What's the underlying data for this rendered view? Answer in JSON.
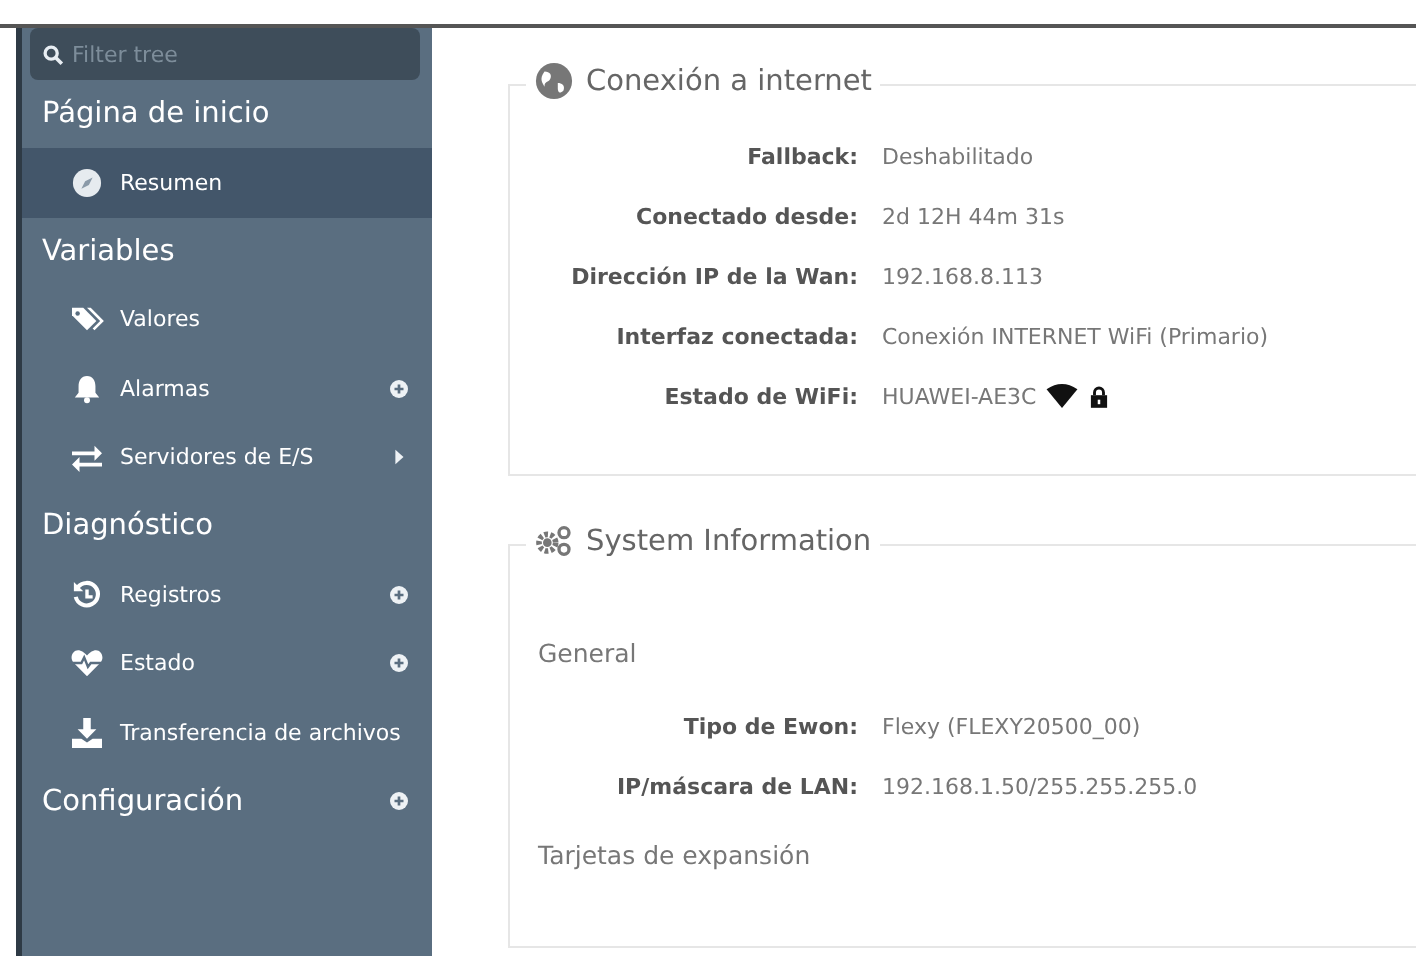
{
  "filter": {
    "placeholder": "Filter tree"
  },
  "nav": [
    {
      "kind": "heading",
      "label": "Página de inicio"
    },
    {
      "kind": "item",
      "label": "Resumen",
      "selected": true
    },
    {
      "kind": "heading",
      "label": "Variables"
    },
    {
      "kind": "item",
      "label": "Valores",
      "selected": false
    },
    {
      "kind": "item",
      "label": "Alarmas",
      "selected": false,
      "expandable": true
    },
    {
      "kind": "item",
      "label": "Servidores de E/S",
      "selected": false,
      "submenu": true
    },
    {
      "kind": "heading",
      "label": "Diagnóstico"
    },
    {
      "kind": "item",
      "label": "Registros",
      "selected": false,
      "expandable": true
    },
    {
      "kind": "item",
      "label": "Estado",
      "selected": false,
      "expandable": true
    },
    {
      "kind": "item",
      "label": "Transferencia de archivos",
      "selected": false
    },
    {
      "kind": "heading",
      "label": "Configuración",
      "expandable": true
    }
  ],
  "sections": [
    {
      "title": "Conexión a internet",
      "blocks": [
        {
          "kind": "row",
          "label": "Fallback:",
          "value": "Deshabilitado"
        },
        {
          "kind": "row",
          "label": "Conectado desde:",
          "value": "2d 12H 44m 31s"
        },
        {
          "kind": "row",
          "label": "Dirección IP de la Wan:",
          "value": "192.168.8.113"
        },
        {
          "kind": "row",
          "label": "Interfaz conectada:",
          "value": "Conexión INTERNET WiFi (Primario)"
        },
        {
          "kind": "wifi",
          "label": "Estado de WiFi:",
          "value": "HUAWEI-AE3C"
        }
      ]
    },
    {
      "title": "System Information",
      "blocks": [
        {
          "kind": "heading",
          "text": "General"
        },
        {
          "kind": "row",
          "label": "Tipo de Ewon:",
          "value": "Flexy (FLEXY20500_00)"
        },
        {
          "kind": "row",
          "label": "IP/máscara de LAN:",
          "value": "192.168.1.50/255.255.255.0"
        },
        {
          "kind": "heading",
          "text": "Tarjetas de expansión"
        }
      ]
    }
  ]
}
